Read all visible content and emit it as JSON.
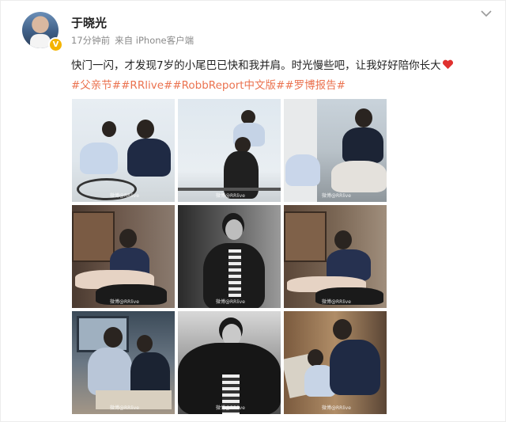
{
  "post": {
    "username": "于晓光",
    "time": "17分钟前",
    "source": "来自 iPhone客户端",
    "text": "快门一闪，才发现7岁的小尾巴已快和我并肩。时光慢些吧，让我好好陪你长大",
    "tags": [
      "#父亲节#",
      "#RRlive#",
      "#RobbReport中文版#",
      "#罗博报告#"
    ],
    "verified_badge": "V"
  },
  "photos": [
    {
      "name": "photo-1",
      "icon": "bicycle-father-son-photo"
    },
    {
      "name": "photo-2",
      "icon": "piggyback-photo"
    },
    {
      "name": "photo-3",
      "icon": "sitting-window-photo"
    },
    {
      "name": "photo-4",
      "icon": "lying-bookshelf-photo"
    },
    {
      "name": "photo-5",
      "icon": "bw-portrait-photo"
    },
    {
      "name": "photo-6",
      "icon": "lying-bookshelf-2-photo"
    },
    {
      "name": "photo-7",
      "icon": "desk-reading-photo"
    },
    {
      "name": "photo-8",
      "icon": "bw-portrait-hand-photo"
    },
    {
      "name": "photo-9",
      "icon": "playing-magazine-photo"
    }
  ],
  "watermark": "微博@RRlive",
  "colors": {
    "tag": "#eb7350",
    "meta": "#8a8a8a",
    "heart": "#e0312f",
    "verified": "#f4b400"
  }
}
